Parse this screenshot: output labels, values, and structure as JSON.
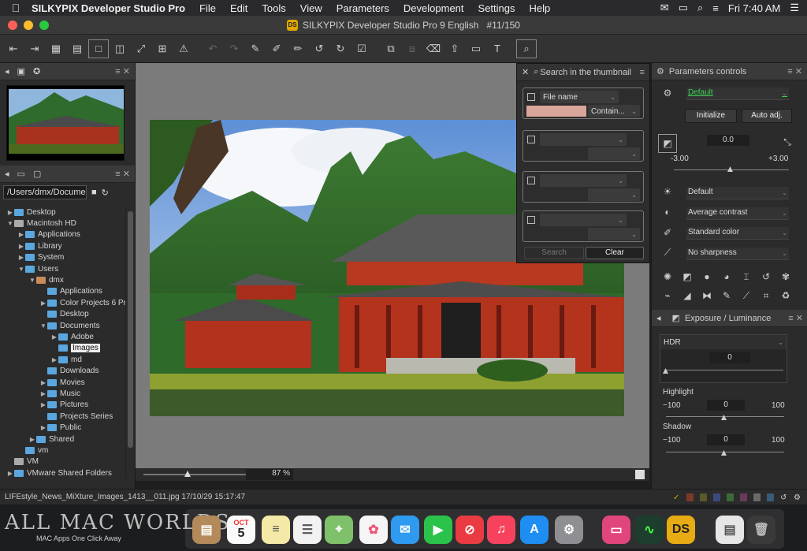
{
  "menubar": {
    "app_name": "SILKYPIX Developer Studio Pro",
    "menus": [
      "File",
      "Edit",
      "Tools",
      "View",
      "Parameters",
      "Development",
      "Settings",
      "Help"
    ],
    "clock": "Fri 7:40 AM"
  },
  "window": {
    "title": "SILKYPIX Developer Studio Pro 9 English",
    "counter": "#11/150"
  },
  "thumbnail_panel": {},
  "browser": {
    "path": "/Users/dmx/Docume",
    "tree": [
      {
        "label": "Desktop",
        "indent": 0,
        "arrow": "▶",
        "icon": "folder"
      },
      {
        "label": "Macintosh HD",
        "indent": 0,
        "arrow": "▼",
        "icon": "drive"
      },
      {
        "label": "Applications",
        "indent": 1,
        "arrow": "▶",
        "icon": "folder"
      },
      {
        "label": "Library",
        "indent": 1,
        "arrow": "▶",
        "icon": "folder"
      },
      {
        "label": "System",
        "indent": 1,
        "arrow": "▶",
        "icon": "folder"
      },
      {
        "label": "Users",
        "indent": 1,
        "arrow": "▼",
        "icon": "folder"
      },
      {
        "label": "dmx",
        "indent": 2,
        "arrow": "▼",
        "icon": "home"
      },
      {
        "label": "Applications",
        "indent": 3,
        "arrow": "",
        "icon": "folder"
      },
      {
        "label": "Color Projects 6 Pr",
        "indent": 3,
        "arrow": "▶",
        "icon": "folder"
      },
      {
        "label": "Desktop",
        "indent": 3,
        "arrow": "",
        "icon": "folder"
      },
      {
        "label": "Documents",
        "indent": 3,
        "arrow": "▼",
        "icon": "folder"
      },
      {
        "label": "Adobe",
        "indent": 4,
        "arrow": "▶",
        "icon": "folder"
      },
      {
        "label": "Images",
        "indent": 4,
        "arrow": "",
        "icon": "folder",
        "selected": true
      },
      {
        "label": "md",
        "indent": 4,
        "arrow": "▶",
        "icon": "folder"
      },
      {
        "label": "Downloads",
        "indent": 3,
        "arrow": "",
        "icon": "folder"
      },
      {
        "label": "Movies",
        "indent": 3,
        "arrow": "▶",
        "icon": "folder"
      },
      {
        "label": "Music",
        "indent": 3,
        "arrow": "▶",
        "icon": "folder"
      },
      {
        "label": "Pictures",
        "indent": 3,
        "arrow": "▶",
        "icon": "folder"
      },
      {
        "label": "Projects Series",
        "indent": 3,
        "arrow": "",
        "icon": "folder"
      },
      {
        "label": "Public",
        "indent": 3,
        "arrow": "▶",
        "icon": "folder"
      },
      {
        "label": "Shared",
        "indent": 2,
        "arrow": "▶",
        "icon": "folder"
      },
      {
        "label": "vm",
        "indent": 1,
        "arrow": "",
        "icon": "folder"
      },
      {
        "label": "VM",
        "indent": 0,
        "arrow": "",
        "icon": "drive"
      },
      {
        "label": "VMware Shared Folders",
        "indent": 0,
        "arrow": "▶",
        "icon": "folder"
      }
    ]
  },
  "preview": {
    "zoom": "87 %"
  },
  "search_panel": {
    "title": "Search in the thumbnail",
    "criterion_1": "File name",
    "criterion_1_mode": "Contain...",
    "search_button": "Search",
    "clear_button": "Clear"
  },
  "parameters_panel": {
    "title": "Parameters controls",
    "preset": "Default",
    "initialize_button": "Initialize",
    "auto_adj_button": "Auto adj.",
    "exposure_value": "0.0",
    "exposure_min": "-3.00",
    "exposure_max": "+3.00",
    "white_balance": "Default",
    "tone": "Average contrast",
    "color": "Standard color",
    "sharpness": "No sharpness"
  },
  "exposure_panel": {
    "title": "Exposure / Luminance",
    "mode": "HDR",
    "hdr_value": "0",
    "highlight_label": "Highlight",
    "highlight_min": "−100",
    "highlight_value": "0",
    "highlight_max": "100",
    "shadow_label": "Shadow",
    "shadow_min": "−100",
    "shadow_value": "0",
    "shadow_max": "100"
  },
  "statusbar": {
    "file_info": "LIFEstyle_News_MiXture_Images_1413__011.jpg 17/10/29 15:17:47"
  },
  "dock": {
    "calendar_month": "OCT",
    "calendar_day": "5",
    "active_app_label": "DS"
  },
  "watermark": {
    "brand": "ALL MAC WORLDS",
    "tagline": "MAC Apps One Click Away"
  },
  "colors": {
    "accent_green": "#39d353",
    "selection_rose": "#d9a59a",
    "folder_blue": "#5aa7e0"
  }
}
